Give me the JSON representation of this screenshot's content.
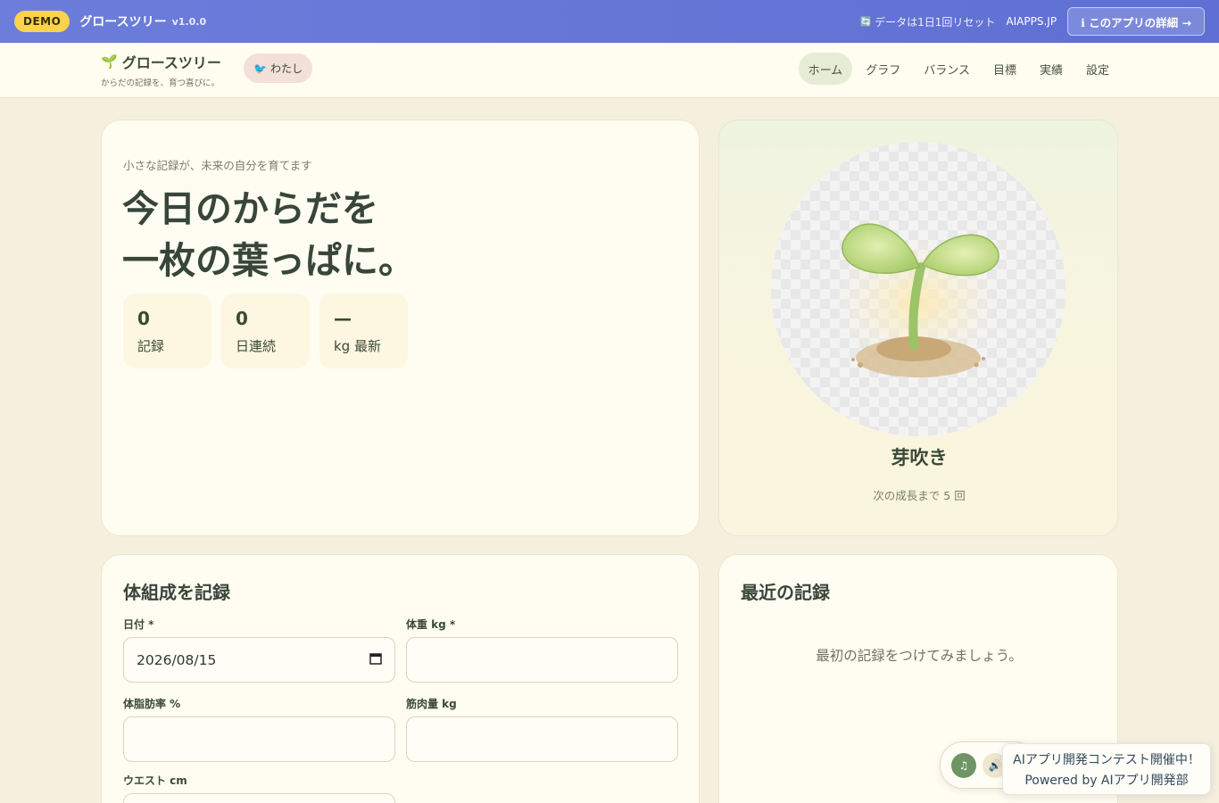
{
  "topbar": {
    "badge": "DEMO",
    "title": "グロースツリー",
    "version": "v1.0.0",
    "reset_icon": "🔄",
    "reset_note": "データは1日1回リセット",
    "site": "AIAPPS.JP",
    "detail_button": "ℹ このアプリの詳細 →"
  },
  "nav": {
    "brand_icon": "🌱",
    "brand_title": "グロースツリー",
    "brand_sub": "からだの記録を、育つ喜びに。",
    "user_icon": "🐦",
    "user_label": "わたし",
    "links": [
      "ホーム",
      "グラフ",
      "バランス",
      "目標",
      "実績",
      "設定"
    ],
    "active": "ホーム"
  },
  "hero": {
    "kicker": "小さな記録が、未来の自分を育てます",
    "title_line1": "今日のからだを",
    "title_line2": "一枚の葉っぱに。",
    "stats": [
      {
        "value": "0",
        "label": "記録"
      },
      {
        "value": "0",
        "label": "日連続"
      },
      {
        "value": "—",
        "label": "kg 最新"
      }
    ]
  },
  "plant": {
    "stage": "芽吹き",
    "next": "次の成長まで 5 回"
  },
  "form": {
    "title": "体組成を記録",
    "date_label": "日付 *",
    "date_value": "2026/08/15",
    "weight_label": "体重 kg *",
    "weight_value": "",
    "fat_label": "体脂肪率 %",
    "fat_value": "",
    "muscle_label": "筋肉量 kg",
    "muscle_value": "",
    "waist_label": "ウエスト cm",
    "waist_value": ""
  },
  "recent": {
    "title": "最近の記録",
    "empty": "最初の記録をつけてみましょう。"
  },
  "widgets": {
    "music_icon": "♫",
    "speaker_icon": "🔊",
    "contest_line1": "AIアプリ開発コンテスト開催中！",
    "contest_line2": "Powered by AIアプリ開発部"
  },
  "colors": {
    "topbar": "#6c7ddb",
    "background": "#f5f0dd",
    "accent_green": "#6f9564",
    "demo_badge": "#fcd34d"
  }
}
